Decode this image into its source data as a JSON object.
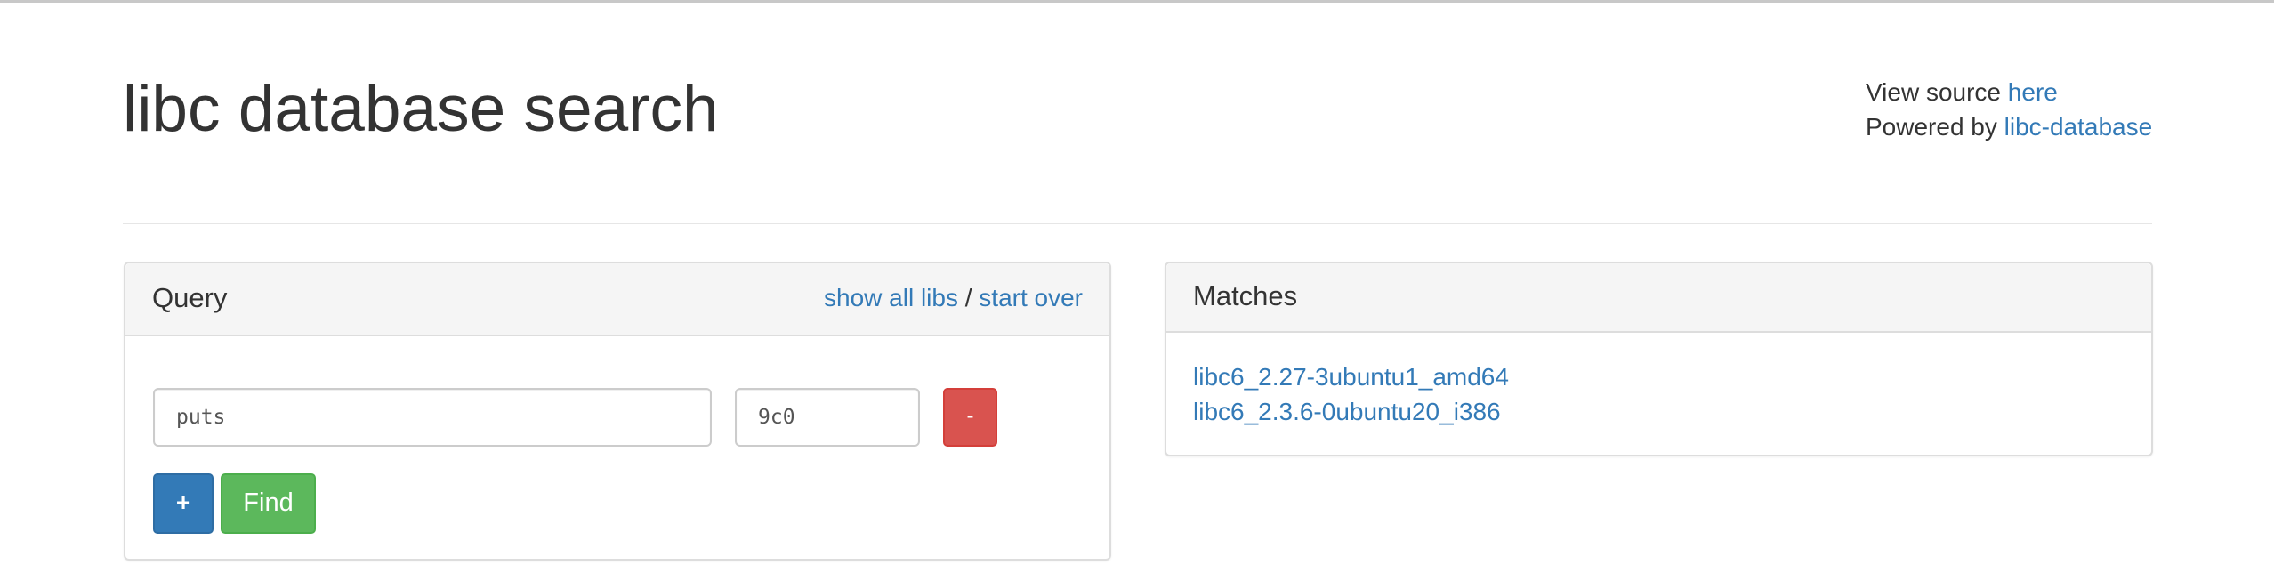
{
  "header": {
    "title": "libc database search",
    "view_source_prefix": "View source ",
    "view_source_link": "here",
    "powered_by_prefix": "Powered by ",
    "powered_by_link": "libc-database"
  },
  "query": {
    "panel_title": "Query",
    "show_all_libs": "show all libs",
    "separator": " / ",
    "start_over": "start over",
    "rows": [
      {
        "symbol": "puts",
        "address": "9c0",
        "remove_label": "-"
      }
    ],
    "add_label": "+",
    "find_label": "Find"
  },
  "matches": {
    "panel_title": "Matches",
    "items": [
      "libc6_2.27-3ubuntu1_amd64",
      "libc6_2.3.6-0ubuntu20_i386"
    ]
  },
  "colors": {
    "link": "#337ab7",
    "danger": "#d9534f",
    "primary": "#337ab7",
    "success": "#5cb85c",
    "panel_heading_bg": "#f5f5f5",
    "border": "#dddddd"
  }
}
